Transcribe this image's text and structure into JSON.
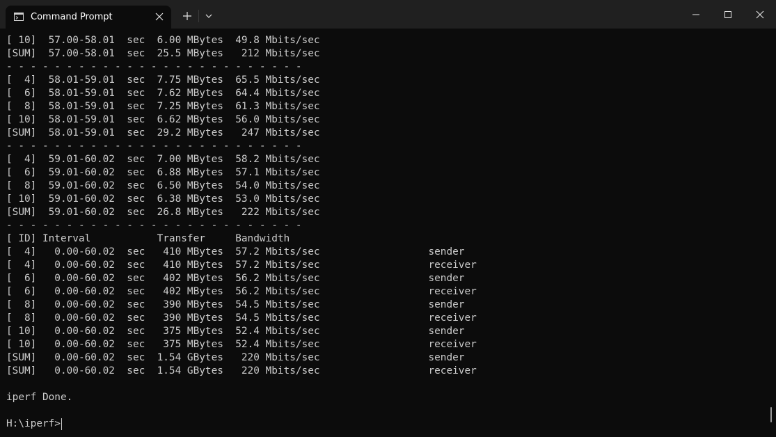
{
  "window": {
    "tab_title": "Command Prompt",
    "icons": {
      "app": "terminal-icon",
      "tab_close": "close-icon",
      "new_tab": "plus-icon",
      "dropdown": "chevron-down-icon",
      "minimize": "minimize-icon",
      "maximize": "maximize-icon",
      "close": "close-icon"
    },
    "colors": {
      "titlebar": "#202020",
      "terminal_bg": "#0c0c0c",
      "text": "#cccccc"
    }
  },
  "terminal": {
    "lines": [
      "[ 10]  57.00-58.01  sec  6.00 MBytes  49.8 Mbits/sec",
      "[SUM]  57.00-58.01  sec  25.5 MBytes   212 Mbits/sec",
      "- - - - - - - - - - - - - - - - - - - - - - - - -",
      "[  4]  58.01-59.01  sec  7.75 MBytes  65.5 Mbits/sec",
      "[  6]  58.01-59.01  sec  7.62 MBytes  64.4 Mbits/sec",
      "[  8]  58.01-59.01  sec  7.25 MBytes  61.3 Mbits/sec",
      "[ 10]  58.01-59.01  sec  6.62 MBytes  56.0 Mbits/sec",
      "[SUM]  58.01-59.01  sec  29.2 MBytes   247 Mbits/sec",
      "- - - - - - - - - - - - - - - - - - - - - - - - -",
      "[  4]  59.01-60.02  sec  7.00 MBytes  58.2 Mbits/sec",
      "[  6]  59.01-60.02  sec  6.88 MBytes  57.1 Mbits/sec",
      "[  8]  59.01-60.02  sec  6.50 MBytes  54.0 Mbits/sec",
      "[ 10]  59.01-60.02  sec  6.38 MBytes  53.0 Mbits/sec",
      "[SUM]  59.01-60.02  sec  26.8 MBytes   222 Mbits/sec",
      "- - - - - - - - - - - - - - - - - - - - - - - - -",
      "[ ID] Interval           Transfer     Bandwidth",
      "[  4]   0.00-60.02  sec   410 MBytes  57.2 Mbits/sec                  sender",
      "[  4]   0.00-60.02  sec   410 MBytes  57.2 Mbits/sec                  receiver",
      "[  6]   0.00-60.02  sec   402 MBytes  56.2 Mbits/sec                  sender",
      "[  6]   0.00-60.02  sec   402 MBytes  56.2 Mbits/sec                  receiver",
      "[  8]   0.00-60.02  sec   390 MBytes  54.5 Mbits/sec                  sender",
      "[  8]   0.00-60.02  sec   390 MBytes  54.5 Mbits/sec                  receiver",
      "[ 10]   0.00-60.02  sec   375 MBytes  52.4 Mbits/sec                  sender",
      "[ 10]   0.00-60.02  sec   375 MBytes  52.4 Mbits/sec                  receiver",
      "[SUM]   0.00-60.02  sec  1.54 GBytes   220 Mbits/sec                  sender",
      "[SUM]   0.00-60.02  sec  1.54 GBytes   220 Mbits/sec                  receiver",
      "",
      "iperf Done.",
      ""
    ],
    "prompt": "H:\\iperf>"
  }
}
